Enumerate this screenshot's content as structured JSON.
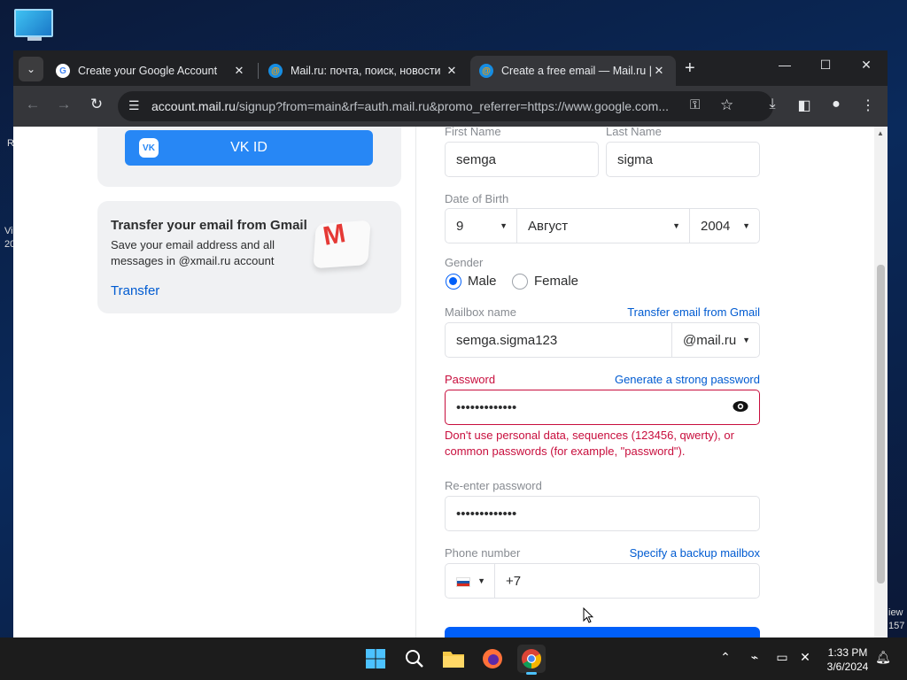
{
  "desktop": {
    "side_texts": [
      "R",
      "Vi",
      "20",
      "iew",
      "157"
    ]
  },
  "browser": {
    "tabs": [
      {
        "title": "Create your Google Account",
        "favicon": "google-icon",
        "active": false
      },
      {
        "title": "Mail.ru: почта, поиск, новости",
        "favicon": "mailru-icon",
        "active": false
      },
      {
        "title": "Create a free email — Mail.ru | E",
        "favicon": "mailru-icon",
        "active": true
      }
    ],
    "url": {
      "host": "account.mail.ru",
      "path": "/signup?from=main&rf=auth.mail.ru&promo_referrer=https://www.google.com..."
    }
  },
  "left_panel": {
    "vk_button": "VK ID",
    "gmail_card": {
      "title": "Transfer your email from Gmail",
      "description": "Save your email address and all messages in @xmail.ru account",
      "link": "Transfer"
    }
  },
  "form": {
    "first_name": {
      "label": "First Name",
      "value": "semga"
    },
    "last_name": {
      "label": "Last Name",
      "value": "sigma"
    },
    "dob": {
      "label": "Date of Birth",
      "day": "9",
      "month": "Август",
      "year": "2004"
    },
    "gender": {
      "label": "Gender",
      "options": [
        "Male",
        "Female"
      ],
      "selected": "Male"
    },
    "mailbox": {
      "label": "Mailbox name",
      "link": "Transfer email from Gmail",
      "value": "semga.sigma123",
      "domain": "@mail.ru"
    },
    "password": {
      "label": "Password",
      "link": "Generate a strong password",
      "value": "•••••••••••••",
      "error": "Don't use personal data, sequences (123456, qwerty), or common passwords (for example, \"password\")."
    },
    "reenter": {
      "label": "Re-enter password",
      "value": "•••••••••••••"
    },
    "phone": {
      "label": "Phone number",
      "link": "Specify a backup mailbox",
      "value": "+7"
    }
  },
  "taskbar": {
    "time": "1:33 PM",
    "date": "3/6/2024"
  },
  "colors": {
    "accent": "#005ff9",
    "vk_blue": "#2787f5",
    "error": "#c80e3d",
    "link": "#005bd1"
  }
}
